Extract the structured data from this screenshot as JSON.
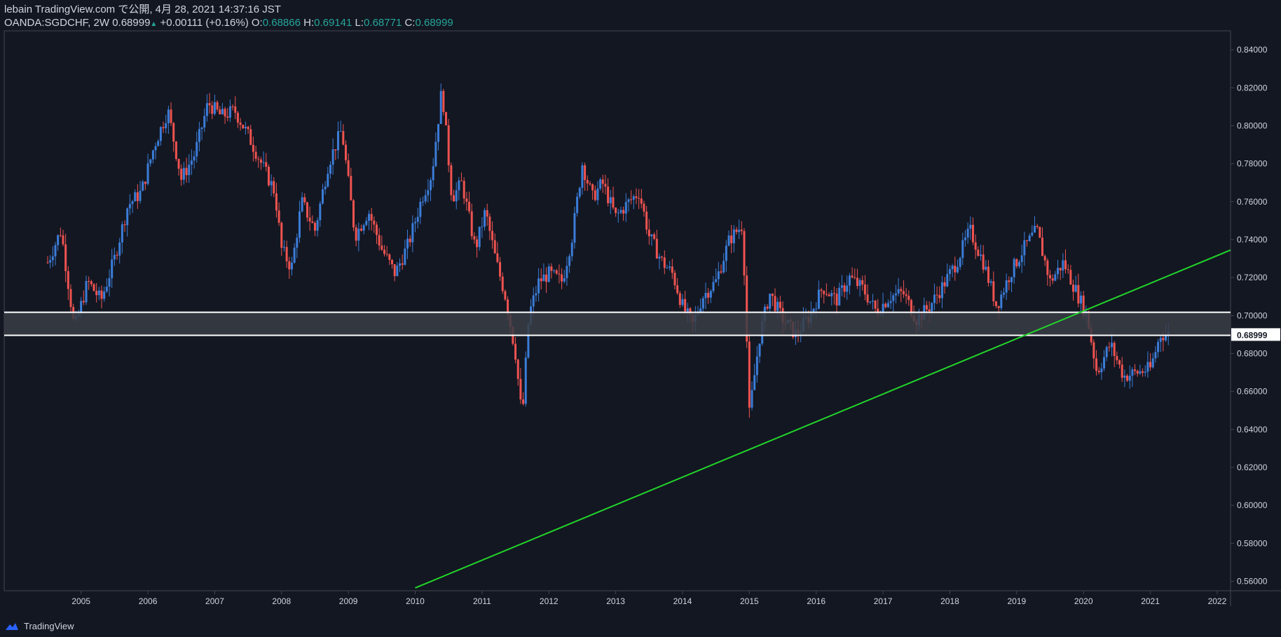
{
  "header": {
    "publish_line": "lebain TradingView.com で公開, 4月 28, 2021 14:37:16 JST",
    "symbol_interval": "OANDA:SGDCHF, 2W",
    "last_price": "0.68999",
    "change": "+0.00111 (+0.16%)",
    "o_label": "O:",
    "o_value": "0.68866",
    "h_label": "H:",
    "h_value": "0.69141",
    "l_label": "L:",
    "l_value": "0.68771",
    "c_label": "C:",
    "c_value": "0.68999"
  },
  "footer": {
    "brand": "TradingView"
  },
  "colors": {
    "background": "#131722",
    "up_candle": "#3b7dd8",
    "down_candle": "#ef5350",
    "trendline": "#22d629",
    "zone_fill": "#3a3d45",
    "zone_border": "#ffffff",
    "price_label_bg": "#ffffff",
    "grid_border": "#434651"
  },
  "chart_data": {
    "type": "candlestick",
    "symbol": "OANDA:SGDCHF",
    "interval": "2W",
    "ylim": [
      0.555,
      0.85
    ],
    "y_ticks": [
      "0.84000",
      "0.82000",
      "0.80000",
      "0.78000",
      "0.76000",
      "0.74000",
      "0.72000",
      "0.70000",
      "0.68000",
      "0.66000",
      "0.64000",
      "0.62000",
      "0.60000",
      "0.58000",
      "0.56000"
    ],
    "x_ticks": [
      "2005",
      "2006",
      "2007",
      "2008",
      "2009",
      "2010",
      "2011",
      "2012",
      "2013",
      "2014",
      "2015",
      "2016",
      "2017",
      "2018",
      "2019",
      "2020",
      "2021",
      "2022"
    ],
    "xlim": [
      2003.85,
      2022.2
    ],
    "current_price_label": "0.68999",
    "close_series": [
      [
        2004.5,
        0.728
      ],
      [
        2004.7,
        0.745
      ],
      [
        2004.9,
        0.693
      ],
      [
        2005.1,
        0.718
      ],
      [
        2005.3,
        0.708
      ],
      [
        2005.5,
        0.73
      ],
      [
        2005.7,
        0.758
      ],
      [
        2005.9,
        0.765
      ],
      [
        2006.1,
        0.79
      ],
      [
        2006.3,
        0.808
      ],
      [
        2006.5,
        0.772
      ],
      [
        2006.7,
        0.785
      ],
      [
        2006.9,
        0.812
      ],
      [
        2007.1,
        0.805
      ],
      [
        2007.3,
        0.808
      ],
      [
        2007.5,
        0.795
      ],
      [
        2007.7,
        0.78
      ],
      [
        2007.9,
        0.765
      ],
      [
        2008.0,
        0.735
      ],
      [
        2008.15,
        0.725
      ],
      [
        2008.3,
        0.76
      ],
      [
        2008.5,
        0.745
      ],
      [
        2008.7,
        0.78
      ],
      [
        2008.9,
        0.798
      ],
      [
        2009.1,
        0.742
      ],
      [
        2009.3,
        0.755
      ],
      [
        2009.5,
        0.735
      ],
      [
        2009.7,
        0.722
      ],
      [
        2009.9,
        0.738
      ],
      [
        2010.1,
        0.762
      ],
      [
        2010.25,
        0.775
      ],
      [
        2010.4,
        0.82
      ],
      [
        2010.55,
        0.762
      ],
      [
        2010.7,
        0.77
      ],
      [
        2010.9,
        0.735
      ],
      [
        2011.05,
        0.755
      ],
      [
        2011.2,
        0.73
      ],
      [
        2011.35,
        0.71
      ],
      [
        2011.5,
        0.68
      ],
      [
        2011.6,
        0.645
      ],
      [
        2011.7,
        0.7
      ],
      [
        2011.85,
        0.718
      ],
      [
        2012.0,
        0.722
      ],
      [
        2012.2,
        0.718
      ],
      [
        2012.35,
        0.742
      ],
      [
        2012.5,
        0.78
      ],
      [
        2012.65,
        0.762
      ],
      [
        2012.8,
        0.77
      ],
      [
        2013.0,
        0.752
      ],
      [
        2013.2,
        0.76
      ],
      [
        2013.35,
        0.765
      ],
      [
        2013.5,
        0.742
      ],
      [
        2013.7,
        0.728
      ],
      [
        2013.85,
        0.722
      ],
      [
        2014.0,
        0.705
      ],
      [
        2014.15,
        0.695
      ],
      [
        2014.3,
        0.71
      ],
      [
        2014.5,
        0.718
      ],
      [
        2014.7,
        0.74
      ],
      [
        2014.9,
        0.748
      ],
      [
        2015.0,
        0.648
      ],
      [
        2015.15,
        0.688
      ],
      [
        2015.3,
        0.712
      ],
      [
        2015.5,
        0.698
      ],
      [
        2015.7,
        0.69
      ],
      [
        2015.9,
        0.7
      ],
      [
        2016.1,
        0.715
      ],
      [
        2016.3,
        0.708
      ],
      [
        2016.5,
        0.72
      ],
      [
        2016.7,
        0.714
      ],
      [
        2016.9,
        0.702
      ],
      [
        2017.1,
        0.71
      ],
      [
        2017.3,
        0.712
      ],
      [
        2017.5,
        0.698
      ],
      [
        2017.7,
        0.705
      ],
      [
        2017.9,
        0.716
      ],
      [
        2018.1,
        0.728
      ],
      [
        2018.3,
        0.745
      ],
      [
        2018.5,
        0.728
      ],
      [
        2018.7,
        0.705
      ],
      [
        2018.9,
        0.722
      ],
      [
        2019.1,
        0.735
      ],
      [
        2019.3,
        0.745
      ],
      [
        2019.5,
        0.718
      ],
      [
        2019.7,
        0.728
      ],
      [
        2019.9,
        0.712
      ],
      [
        2020.05,
        0.7
      ],
      [
        2020.2,
        0.67
      ],
      [
        2020.4,
        0.685
      ],
      [
        2020.6,
        0.668
      ],
      [
        2020.8,
        0.67
      ],
      [
        2021.0,
        0.672
      ],
      [
        2021.15,
        0.69
      ],
      [
        2021.3,
        0.69
      ]
    ],
    "annotations": [
      {
        "type": "horizontal_zone",
        "upper": 0.7017,
        "lower": 0.6896
      },
      {
        "type": "trendline",
        "from": [
          2010.0,
          0.5565
        ],
        "to": [
          2022.2,
          0.7345
        ]
      }
    ]
  }
}
